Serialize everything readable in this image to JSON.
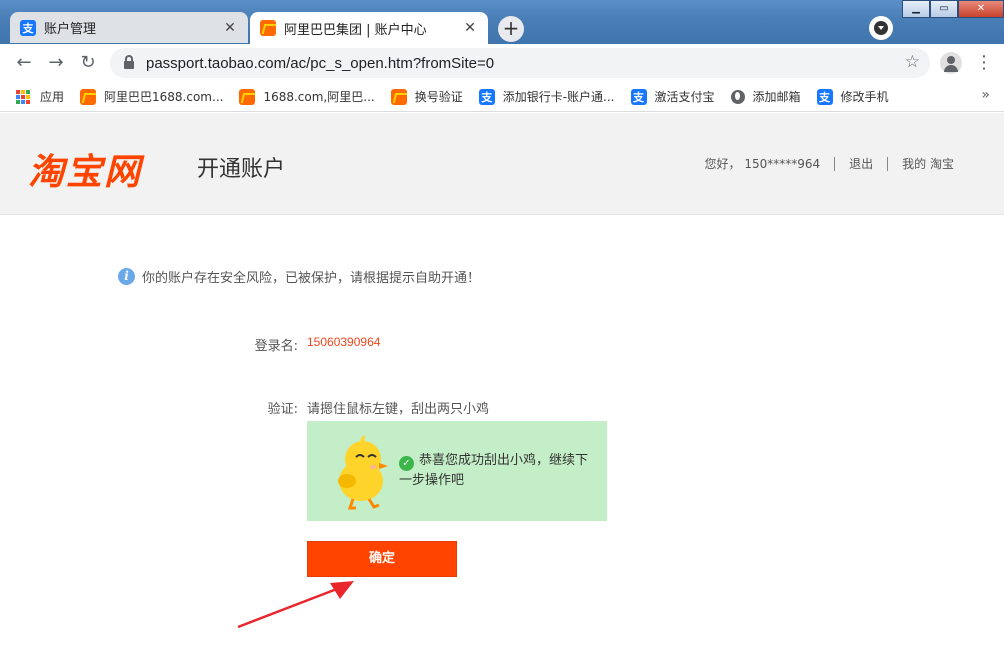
{
  "browser": {
    "tabs": [
      {
        "title": "账户管理",
        "favicon": "alipay-icon",
        "active": false
      },
      {
        "title": "阿里巴巴集团 | 账户中心",
        "favicon": "alibaba-icon",
        "active": true
      }
    ],
    "url": "passport.taobao.com/ac/pc_s_open.htm?fromSite=0",
    "bookmarks": [
      {
        "label": "应用",
        "icon": "apps-grid-icon"
      },
      {
        "label": "阿里巴巴1688.com...",
        "icon": "alibaba-icon"
      },
      {
        "label": "1688.com,阿里巴...",
        "icon": "alibaba-icon"
      },
      {
        "label": "换号验证",
        "icon": "alibaba-icon"
      },
      {
        "label": "添加银行卡-账户通...",
        "icon": "alipay-icon"
      },
      {
        "label": "激活支付宝",
        "icon": "alipay-icon"
      },
      {
        "label": "添加邮箱",
        "icon": "globe-icon"
      },
      {
        "label": "修改手机",
        "icon": "alipay-icon"
      }
    ]
  },
  "header": {
    "logo": "淘宝网",
    "title": "开通账户",
    "greeting": "您好， 150*****964",
    "logout": "退出",
    "my_taobao": "我的 淘宝"
  },
  "content": {
    "notice": "你的账户存在安全风险，已被保护，请根据提示自助开通！",
    "login_label": "登录名:",
    "login_value": "15060390964",
    "verify_label": "验证:",
    "verify_hint": "请摁住鼠标左键，刮出两只小鸡",
    "success_text": "恭喜您成功刮出小鸡，继续下一步操作吧",
    "confirm_button": "确定"
  },
  "colors": {
    "brand": "#ff4400",
    "captcha_bg": "#c4eec8",
    "login_value": "#f0471f"
  }
}
